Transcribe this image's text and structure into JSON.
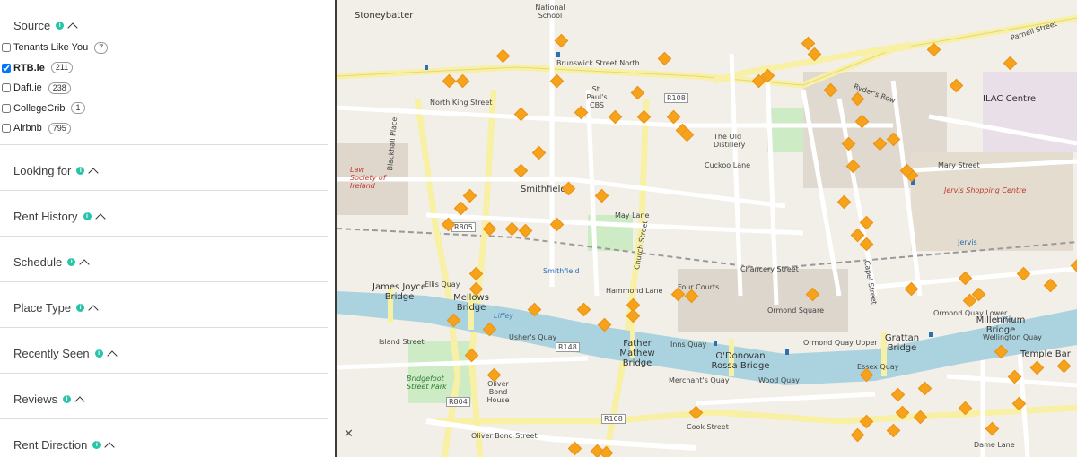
{
  "sidebar": {
    "source": {
      "title": "Source",
      "items": [
        {
          "label": "Tenants Like You",
          "count": "7",
          "checked": false
        },
        {
          "label": "RTB.ie",
          "count": "211",
          "checked": true
        },
        {
          "label": "Daft.ie",
          "count": "238",
          "checked": false
        },
        {
          "label": "CollegeCrib",
          "count": "1",
          "checked": false
        },
        {
          "label": "Airbnb",
          "count": "795",
          "checked": false
        }
      ]
    },
    "sections": [
      {
        "title": "Looking for"
      },
      {
        "title": "Rent History"
      },
      {
        "title": "Schedule"
      },
      {
        "title": "Place Type"
      },
      {
        "title": "Recently Seen"
      },
      {
        "title": "Reviews"
      },
      {
        "title": "Rent Direction"
      }
    ],
    "info_icon_color": "#27c4a8"
  },
  "map": {
    "river_color": "#aad3df",
    "marker_color": "#f7a21b",
    "labels": {
      "stoneybatter": "Stoneybatter",
      "smithfield": "Smithfield",
      "ilac": "ILAC Centre",
      "jervis_centre": "Jervis Shopping Centre",
      "temple_bar": "Temple Bar",
      "liffey": "Liffey",
      "ellis_quay": "Ellis Quay",
      "ushers_quay": "Usher's Quay",
      "inns_quay": "Inns Quay",
      "ormond_quay_upper": "Ormond Quay Upper",
      "ormond_quay_lower": "Ormond Quay Lower",
      "wellington_quay": "Wellington Quay",
      "merchants_quay": "Merchant's Quay",
      "wood_quay": "Wood Quay",
      "essex_quay": "Essex Quay",
      "father_mathew": "Father Mathew Bridge",
      "odonovan": "O'Donovan Rossa Bridge",
      "grattan": "Grattan Bridge",
      "millennium": "Millennium Bridge",
      "james_joyce": "James Joyce Bridge",
      "mellows": "Mellows Bridge",
      "blackhall_place": "Blackhall Place",
      "north_king_street": "North King Street",
      "brunswick": "Brunswick Street North",
      "church_street": "Church Street",
      "capel_street": "Capel Street",
      "mary_street": "Mary Street",
      "chancery_street": "Chancery Street",
      "four_courts": "Four Courts",
      "law_society": "Law Society of Ireland",
      "bridgefoot": "Bridgefoot Street Park",
      "oliver_bond": "Oliver Bond Street",
      "cook_street": "Cook Street",
      "dame_lane": "Dame Lane",
      "parnell_street": "Parnell Street",
      "ryders_row": "Ryder's Row",
      "r108": "R108",
      "r148": "R148",
      "r804": "R804",
      "r805": "R805",
      "jervis": "Jervis",
      "smithfield_stop": "Smithfield",
      "the_old_distillery": "The Old Distillery",
      "national_school": "National School",
      "st_pauls": "St. Paul's CBS",
      "cuckoo_lane": "Cuckoo Lane",
      "may_lane": "May Lane",
      "hammond_lane": "Hammond Lane",
      "ormond_square": "Ormond Square",
      "island_street": "Island Street",
      "oliver_bond_house": "Oliver Bond House"
    }
  }
}
